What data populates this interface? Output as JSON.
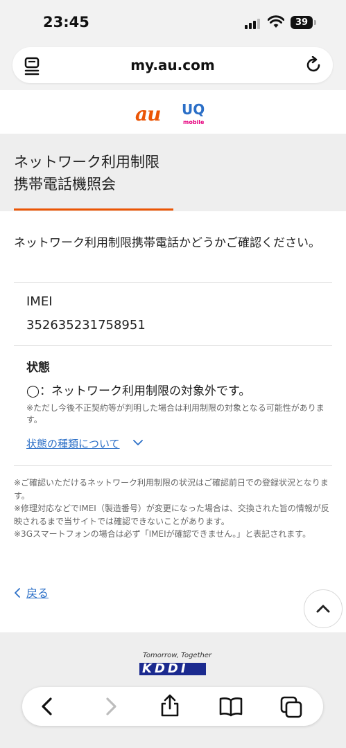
{
  "status_bar": {
    "time": "23:45",
    "battery": "39"
  },
  "browser": {
    "url": "my.au.com",
    "reader_icon": "reader-icon",
    "reload_icon": "reload-icon"
  },
  "logos": {
    "au": "au",
    "uq": "UQ",
    "uq_sub": "mobile"
  },
  "page": {
    "title_line1": "ネットワーク利用制限",
    "title_line2": "携帯電話機照会",
    "intro": "ネットワーク利用制限携帯電話かどうかご確認ください。",
    "imei_label": "IMEI",
    "imei_value": "352635231758951",
    "status_label": "状態",
    "status_value": "◯：ネットワーク利用制限の対象外です。",
    "status_note": "※ただし今後不正契約等が判明した場合は利用制限の対象となる可能性があります。",
    "status_link": "状態の種類について",
    "notes": [
      "※ご確認いただけるネットワーク利用制限の状況はご確認前日での登録状況となります。",
      "※修理対応などでIMEI（製造番号）が変更になった場合は、交換された旨の情報が反映されるまで当サイトでは確認できないことがあります。",
      "※3Gスマートフォンの場合は必ず「IMEIが確認できません。」と表記されます。"
    ],
    "back_link": "戻る"
  },
  "footer": {
    "tagline": "Tomorrow, Together",
    "logo": "KDDI"
  },
  "colors": {
    "accent": "#eb5505",
    "link": "#2b6fc7",
    "uq": "#2b6fc7",
    "uq_sub": "#e6007e"
  },
  "toolbar_icons": [
    "back-icon",
    "forward-icon",
    "share-icon",
    "bookmarks-icon",
    "tabs-icon"
  ]
}
